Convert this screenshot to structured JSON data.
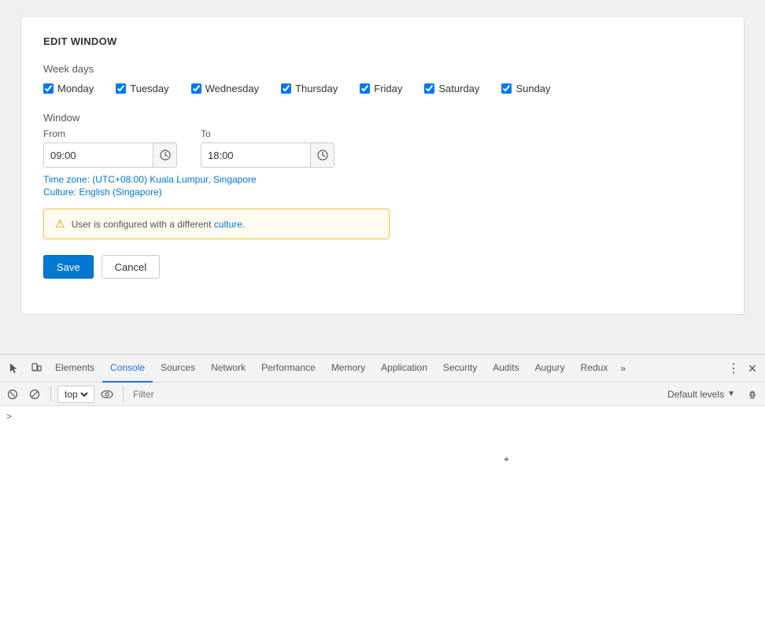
{
  "card": {
    "title": "EDIT WINDOW",
    "weekdays_label": "Week days",
    "days": [
      {
        "id": "monday",
        "label": "Monday",
        "checked": true
      },
      {
        "id": "tuesday",
        "label": "Tuesday",
        "checked": true
      },
      {
        "id": "wednesday",
        "label": "Wednesday",
        "checked": true
      },
      {
        "id": "thursday",
        "label": "Thursday",
        "checked": true
      },
      {
        "id": "friday",
        "label": "Friday",
        "checked": true
      },
      {
        "id": "saturday",
        "label": "Saturday",
        "checked": true
      },
      {
        "id": "sunday",
        "label": "Sunday",
        "checked": true
      }
    ],
    "window_label": "Window",
    "from_label": "From",
    "to_label": "To",
    "from_value": "09:00",
    "to_value": "18:00",
    "timezone": "Time zone: (UTC+08:00) Kuala Lumpur, Singapore",
    "culture": "Culture: English (Singapore)",
    "warning_text": "User is configured with a different culture.",
    "warning_link_text": "culture.",
    "save_label": "Save",
    "cancel_label": "Cancel"
  },
  "devtools": {
    "tabs": [
      {
        "id": "elements",
        "label": "Elements",
        "active": false
      },
      {
        "id": "console",
        "label": "Console",
        "active": true
      },
      {
        "id": "sources",
        "label": "Sources",
        "active": false
      },
      {
        "id": "network",
        "label": "Network",
        "active": false
      },
      {
        "id": "performance",
        "label": "Performance",
        "active": false
      },
      {
        "id": "memory",
        "label": "Memory",
        "active": false
      },
      {
        "id": "application",
        "label": "Application",
        "active": false
      },
      {
        "id": "security",
        "label": "Security",
        "active": false
      },
      {
        "id": "audits",
        "label": "Audits",
        "active": false
      },
      {
        "id": "augury",
        "label": "Augury",
        "active": false
      },
      {
        "id": "redux",
        "label": "Redux",
        "active": false
      }
    ],
    "more_label": "»",
    "context_value": "top",
    "filter_placeholder": "Filter",
    "default_levels_label": "Default levels",
    "console_arrow": ">"
  }
}
